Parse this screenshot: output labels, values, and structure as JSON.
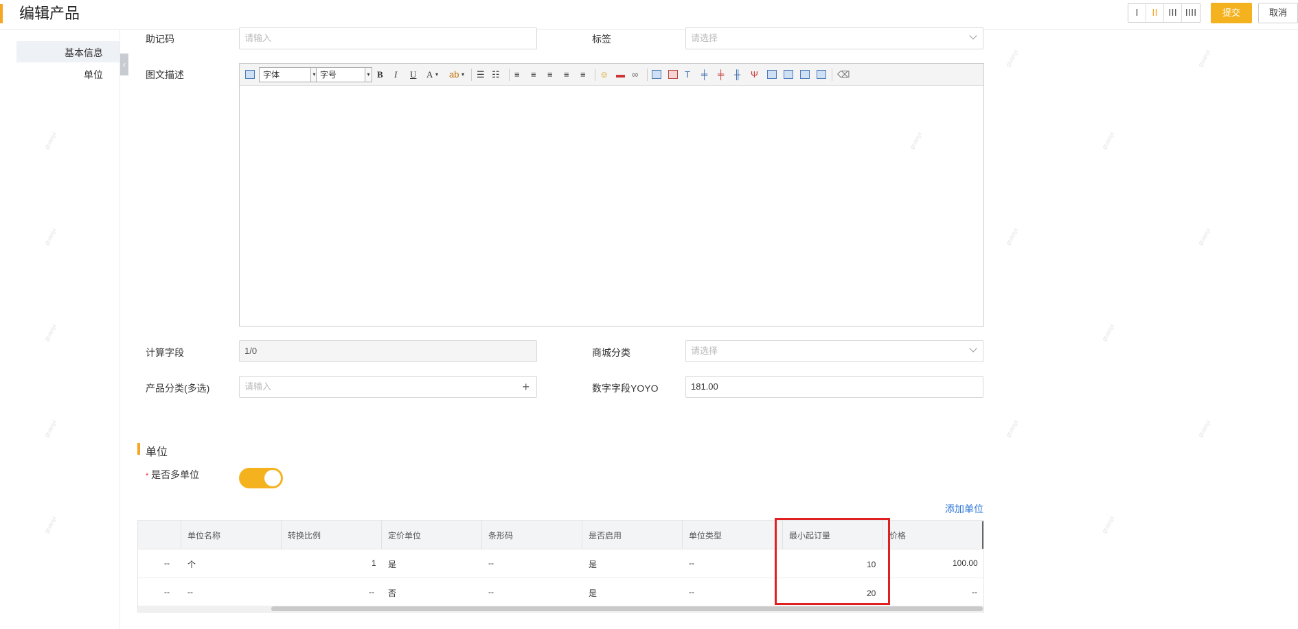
{
  "header": {
    "title": "编辑产品",
    "column_switch": [
      "I",
      "II",
      "III",
      "IIII"
    ],
    "active_columns": "II",
    "submit_label": "提交",
    "cancel_label": "取消"
  },
  "nav": {
    "items": [
      {
        "label": "基本信息",
        "active": true
      },
      {
        "label": "单位",
        "active": false
      }
    ]
  },
  "form": {
    "mnemonic": {
      "label": "助记码",
      "placeholder": "请输入"
    },
    "tags": {
      "label": "标签",
      "placeholder": "请选择"
    },
    "description": {
      "label": "图文描述"
    },
    "editor_toolbar": {
      "font_family": "字体",
      "font_size": "字号",
      "bold": "B",
      "italic": "I",
      "underline": "U",
      "font_color": "A"
    },
    "computed_field": {
      "label": "计算字段",
      "value": "1/0"
    },
    "mall_category": {
      "label": "商城分类",
      "placeholder": "请选择"
    },
    "product_category": {
      "label": "产品分类(多选)",
      "placeholder": "请输入"
    },
    "number_field": {
      "label": "数字字段YOYO",
      "value": "181.00"
    }
  },
  "unit_section": {
    "title": "单位",
    "multi_unit_label": "是否多单位",
    "multi_unit_on": true,
    "add_unit_label": "添加单位",
    "columns": [
      "单位名称",
      "转换比例",
      "定价单位",
      "条形码",
      "是否启用",
      "单位类型",
      "最小起订量",
      "价格"
    ],
    "rows": [
      {
        "index": "--",
        "name": "个",
        "ratio": "1",
        "pricing_unit": "是",
        "barcode": "--",
        "enabled": "是",
        "unit_type": "--",
        "min_order": "10",
        "price": "100.00"
      },
      {
        "index": "--",
        "name": "--",
        "ratio": "--",
        "pricing_unit": "否",
        "barcode": "--",
        "enabled": "是",
        "unit_type": "--",
        "min_order": "20",
        "price": "--"
      }
    ]
  },
  "colors": {
    "accent": "#f5a623",
    "submit_bg": "#f5b21f",
    "link": "#2d76d8",
    "highlight": "#e02020"
  }
}
